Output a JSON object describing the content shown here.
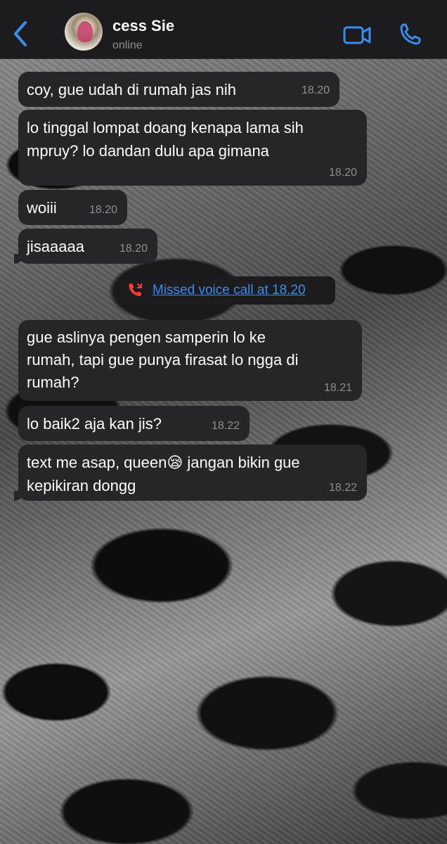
{
  "header": {
    "contact_name": "cess Sie",
    "status": "online"
  },
  "messages": [
    {
      "text": "coy, gue udah di rumah jas nih",
      "time": "18.20"
    },
    {
      "text": "lo tinggal lompat doang kenapa lama sih\nmpruy? lo dandan dulu apa gimana",
      "time": "18.20"
    },
    {
      "text": "woiii",
      "time": "18.20"
    },
    {
      "text": "jisaaaaa",
      "time": "18.20"
    },
    {
      "text": "gue aslinya pengen samperin lo ke\nrumah, tapi gue punya firasat lo ngga di\nrumah?",
      "time": "18.21"
    },
    {
      "text": "lo baik2 aja kan jis?",
      "time": "18.22"
    },
    {
      "text_part1": "text me asap, queen",
      "emoji": "😪",
      "text_part2": " jangan bikin gue\nkepikiran dongg",
      "time": "18.22"
    }
  ],
  "missed_call": {
    "label": "Missed voice call at 18.20"
  },
  "colors": {
    "accent": "#3a8df0",
    "bubble": "#262628",
    "header_bg": "#1c1c1e",
    "missed_call_red": "#ff3b30"
  },
  "icons": {
    "back": "chevron-left-icon",
    "video": "video-camera-icon",
    "call": "phone-icon",
    "missed_call": "missed-call-icon"
  }
}
